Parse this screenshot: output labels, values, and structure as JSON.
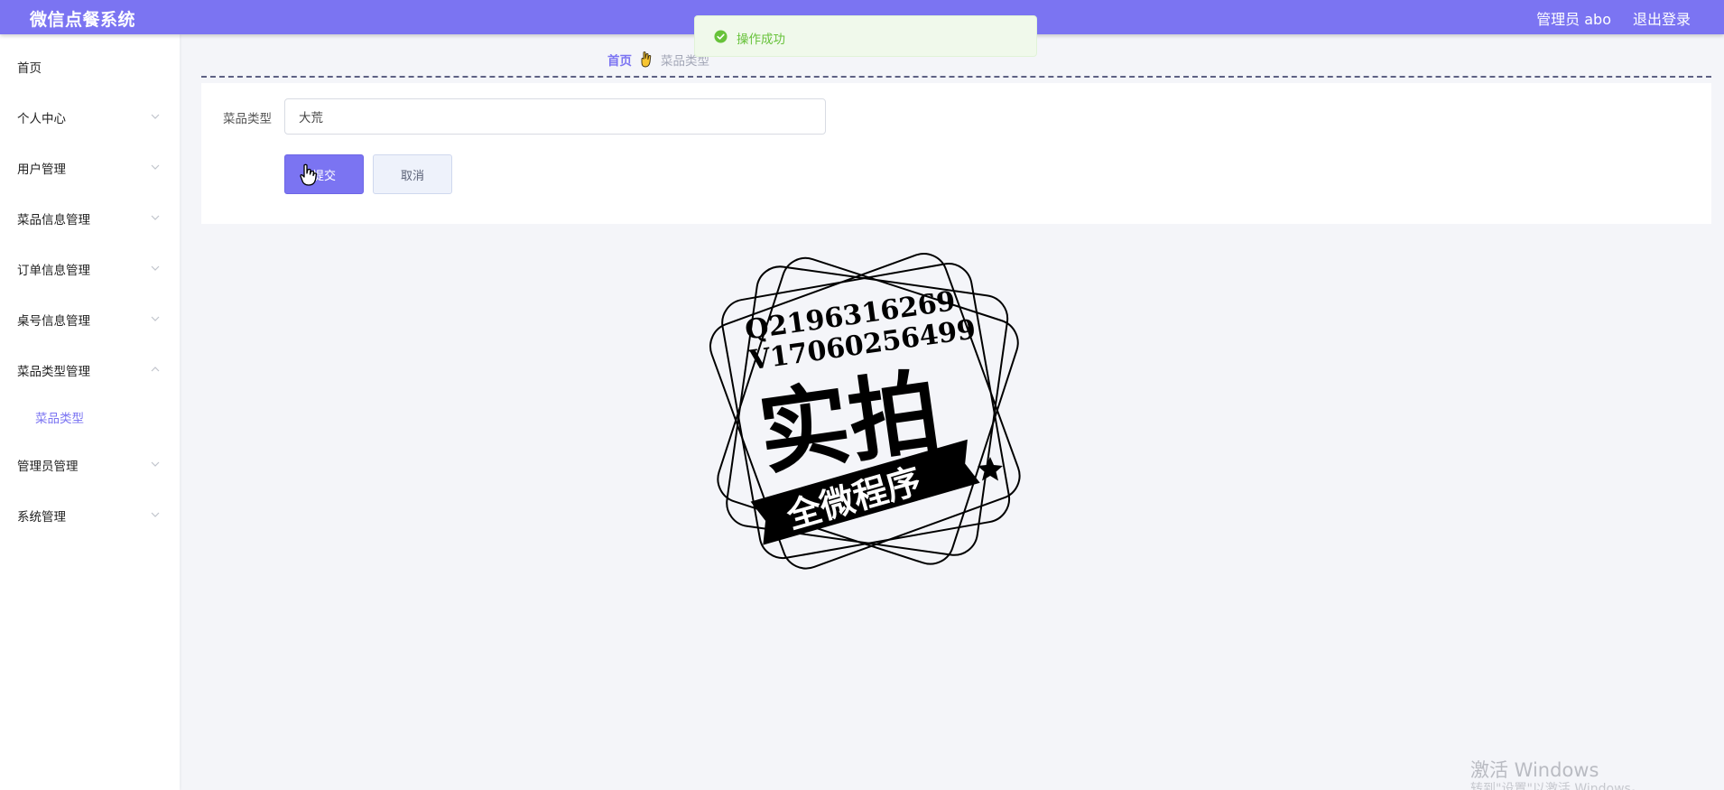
{
  "header": {
    "app_title": "微信点餐系统",
    "user_label": "管理员 abo",
    "logout_label": "退出登录",
    "accent_color": "#7b74f2"
  },
  "sidebar": {
    "items": [
      {
        "label": "首页",
        "icon": "none"
      },
      {
        "label": "个人中心",
        "icon": "chevron-down-icon"
      },
      {
        "label": "用户管理",
        "icon": "chevron-down-icon"
      },
      {
        "label": "菜品信息管理",
        "icon": "chevron-down-icon"
      },
      {
        "label": "订单信息管理",
        "icon": "chevron-down-icon"
      },
      {
        "label": "桌号信息管理",
        "icon": "chevron-down-icon"
      },
      {
        "label": "菜品类型管理",
        "icon": "chevron-up-icon"
      },
      {
        "label": "菜品类型",
        "icon": "none"
      },
      {
        "label": "管理员管理",
        "icon": "chevron-down-icon"
      },
      {
        "label": "系统管理",
        "icon": "chevron-down-icon"
      }
    ]
  },
  "breadcrumb": {
    "home": "首页",
    "current": "菜品类型",
    "separator_icon": "hand-icon"
  },
  "form": {
    "field_label": "菜品类型",
    "field_value": "大荒",
    "submit_label": "提交",
    "cancel_label": "取消"
  },
  "toast": {
    "message": "操作成功",
    "icon": "success-check-icon",
    "color": "#67c23a"
  },
  "stamp": {
    "line1": "Q2196316269",
    "line2": "V17060256499",
    "big_text": "实拍",
    "ribbon_text": "全微程序"
  },
  "os_watermark": {
    "line1": "激活 Windows",
    "line2": "转到\"设置\"以激活 Windows。"
  }
}
